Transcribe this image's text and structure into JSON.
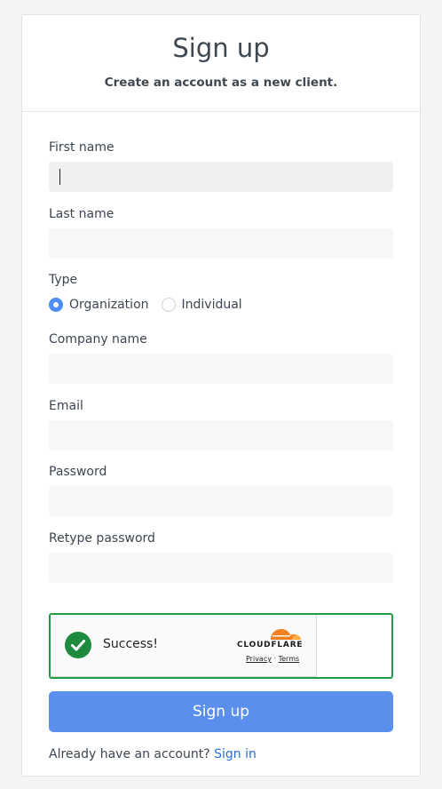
{
  "header": {
    "title": "Sign up",
    "subtitle": "Create an account as a new client."
  },
  "form": {
    "first_name_label": "First name",
    "first_name_value": "",
    "last_name_label": "Last name",
    "last_name_value": "",
    "type_label": "Type",
    "type_options": [
      "Organization",
      "Individual"
    ],
    "type_selected": "Organization",
    "company_label": "Company name",
    "company_value": "",
    "email_label": "Email",
    "email_value": "",
    "password_label": "Password",
    "password_value": "",
    "retype_label": "Retype password",
    "retype_value": ""
  },
  "captcha": {
    "status": "Success!",
    "brand": "CLOUDFLARE",
    "privacy": "Privacy",
    "separator": "·",
    "terms": "Terms",
    "accent": "#1e9e4b",
    "check_icon": "check-circle-icon"
  },
  "submit": {
    "label": "Sign up"
  },
  "footer": {
    "prompt": "Already have an account?",
    "link": "Sign in"
  },
  "colors": {
    "primary": "#5b8fee",
    "link": "#2a6fd6",
    "success": "#1d8a3d",
    "cloudflare_orange": "#f48120"
  }
}
